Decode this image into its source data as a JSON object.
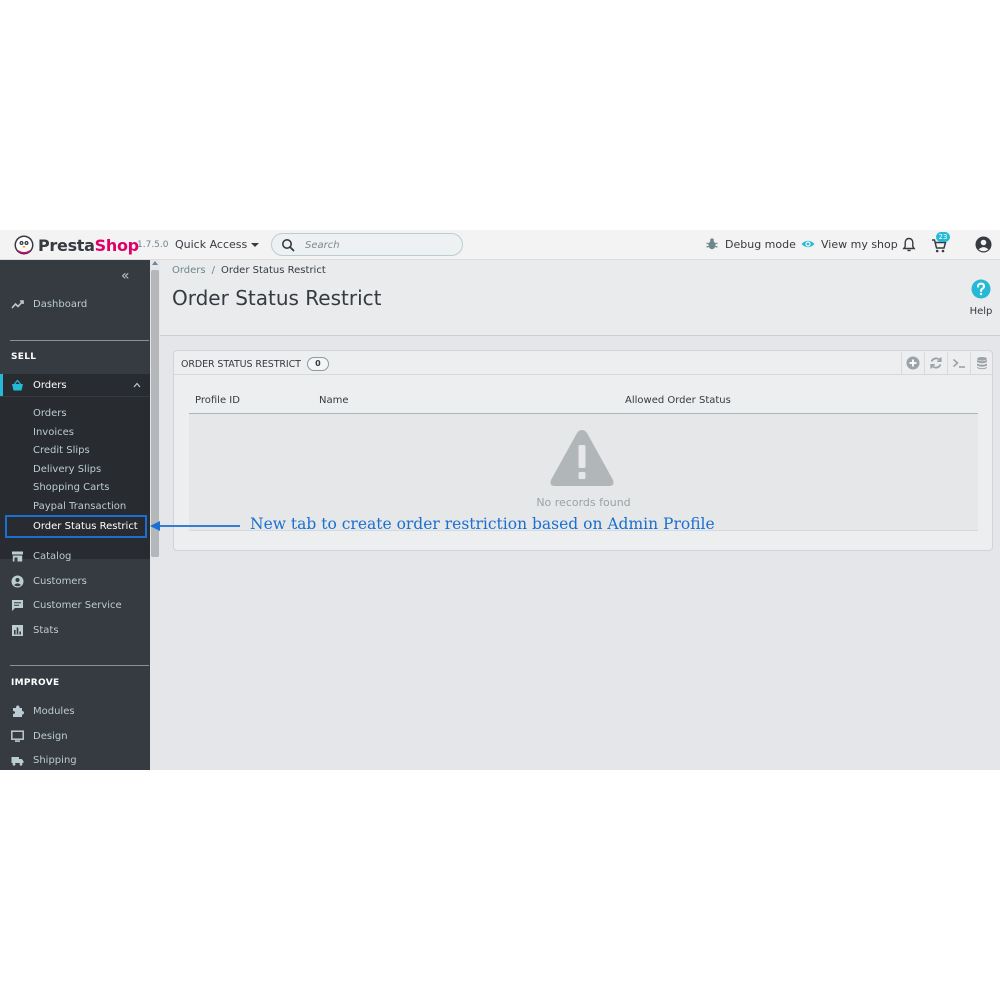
{
  "header": {
    "brand_presta": "Presta",
    "brand_shop": "Shop",
    "version": "1.7.5.0",
    "quick_access": "Quick Access",
    "search_placeholder": "Search",
    "debug_mode": "Debug mode",
    "view_shop": "View my shop",
    "cart_badge": "23"
  },
  "sidebar": {
    "dashboard": "Dashboard",
    "sell_title": "SELL",
    "orders": "Orders",
    "orders_sub": [
      "Orders",
      "Invoices",
      "Credit Slips",
      "Delivery Slips",
      "Shopping Carts",
      "Paypal Transaction",
      "Order Status Restrict"
    ],
    "catalog": "Catalog",
    "customers": "Customers",
    "customer_service": "Customer Service",
    "stats": "Stats",
    "improve_title": "IMPROVE",
    "modules": "Modules",
    "design": "Design",
    "shipping": "Shipping"
  },
  "page": {
    "breadcrumb": [
      "Orders",
      "Order Status Restrict"
    ],
    "breadcrumb_sep": "/",
    "title": "Order Status Restrict",
    "help": "Help"
  },
  "panel": {
    "title": "ORDER STATUS RESTRICT",
    "count": "0",
    "columns": [
      "Profile ID",
      "Name",
      "Allowed Order Status"
    ],
    "empty_message": "No records found"
  },
  "annotation": {
    "text": "New tab to create order restriction based on Admin Profile"
  },
  "colors": {
    "accent": "#25b9d7",
    "brand_pink": "#df0067",
    "sidebar_bg": "#363a41",
    "annotation_blue": "#1a6fd0"
  },
  "icons": [
    "prestashop-logo-icon",
    "search-icon",
    "bug-icon",
    "eye-icon",
    "bell-icon",
    "cart-notification-icon",
    "account-icon",
    "collapse-icon",
    "trending-icon",
    "basket-icon",
    "chevron-up-icon",
    "store-icon",
    "person-icon",
    "chat-icon",
    "stats-icon",
    "puzzle-icon",
    "monitor-icon",
    "truck-icon",
    "help-icon",
    "add-icon",
    "refresh-icon",
    "terminal-icon",
    "database-icon",
    "warning-icon",
    "arrow-left-icon"
  ]
}
